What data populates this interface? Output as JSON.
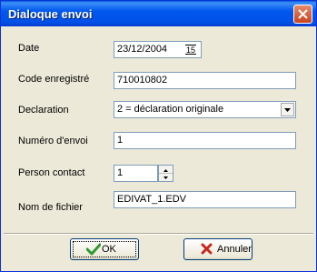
{
  "window": {
    "title": "Dialoque envoi"
  },
  "form": {
    "date": {
      "label": "Date",
      "value": "23/12/2004",
      "picker_glyph": "15"
    },
    "code": {
      "label": "Code enregistré",
      "value": "710010802"
    },
    "declaration": {
      "label": "Declaration",
      "value": "2 = déclaration originale"
    },
    "numero": {
      "label": "Numéro d'envoi",
      "value": "1"
    },
    "person": {
      "label": "Person contact",
      "value": "1"
    },
    "fichier": {
      "label": "Nom de fichier",
      "value": "EDIVAT_1.EDV"
    }
  },
  "buttons": {
    "ok": "OK",
    "cancel": "Annuler"
  },
  "colors": {
    "titlebar": "#0054e3",
    "dialog_bg": "#ece9d8",
    "ok_check": "#2e9b2e",
    "cancel_x": "#c8281e"
  }
}
